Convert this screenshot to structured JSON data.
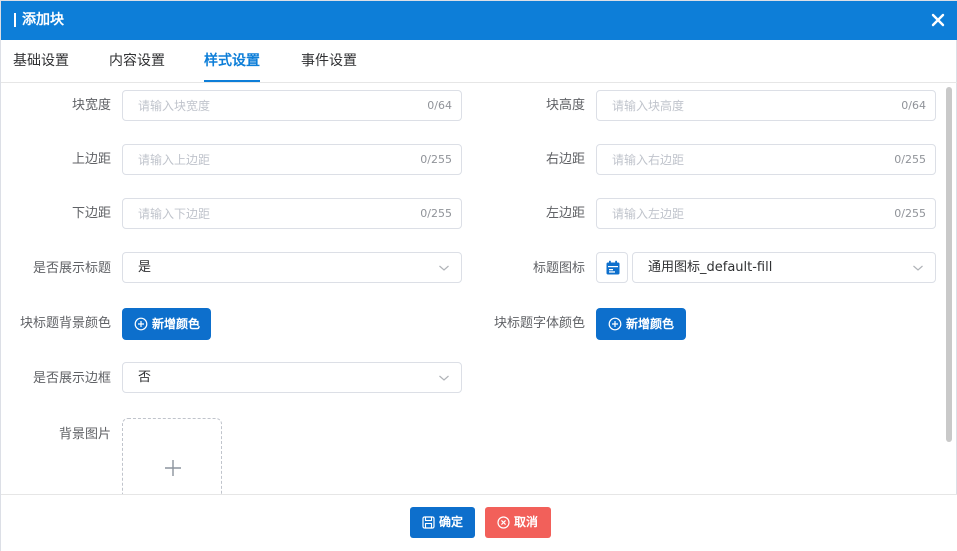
{
  "dialog": {
    "title": "添加块",
    "close_icon": "close-icon"
  },
  "tabs": [
    {
      "label": "基础设置",
      "active": false
    },
    {
      "label": "内容设置",
      "active": false
    },
    {
      "label": "样式设置",
      "active": true
    },
    {
      "label": "事件设置",
      "active": false
    }
  ],
  "form": {
    "block_width": {
      "label": "块宽度",
      "placeholder": "请输入块宽度",
      "count": "0/64"
    },
    "block_height": {
      "label": "块高度",
      "placeholder": "请输入块高度",
      "count": "0/64"
    },
    "margin_top": {
      "label": "上边距",
      "placeholder": "请输入上边距",
      "count": "0/255"
    },
    "margin_right": {
      "label": "右边距",
      "placeholder": "请输入右边距",
      "count": "0/255"
    },
    "margin_bottom": {
      "label": "下边距",
      "placeholder": "请输入下边距",
      "count": "0/255"
    },
    "margin_left": {
      "label": "左边距",
      "placeholder": "请输入左边距",
      "count": "0/255"
    },
    "show_title": {
      "label": "是否展示标题",
      "value": "是"
    },
    "title_icon": {
      "label": "标题图标",
      "value": "通用图标_default-fill",
      "icon": "calendar-icon"
    },
    "title_bg_color": {
      "label": "块标题背景颜色",
      "button": "新增颜色"
    },
    "title_font_color": {
      "label": "块标题字体颜色",
      "button": "新增颜色"
    },
    "show_border": {
      "label": "是否展示边框",
      "value": "否"
    },
    "bg_image": {
      "label": "背景图片",
      "icon": "plus-icon"
    }
  },
  "footer": {
    "confirm": "确定",
    "cancel": "取消"
  },
  "colors": {
    "primary": "#0d7ed8",
    "button": "#0d6fcc",
    "danger": "#f2605a"
  }
}
